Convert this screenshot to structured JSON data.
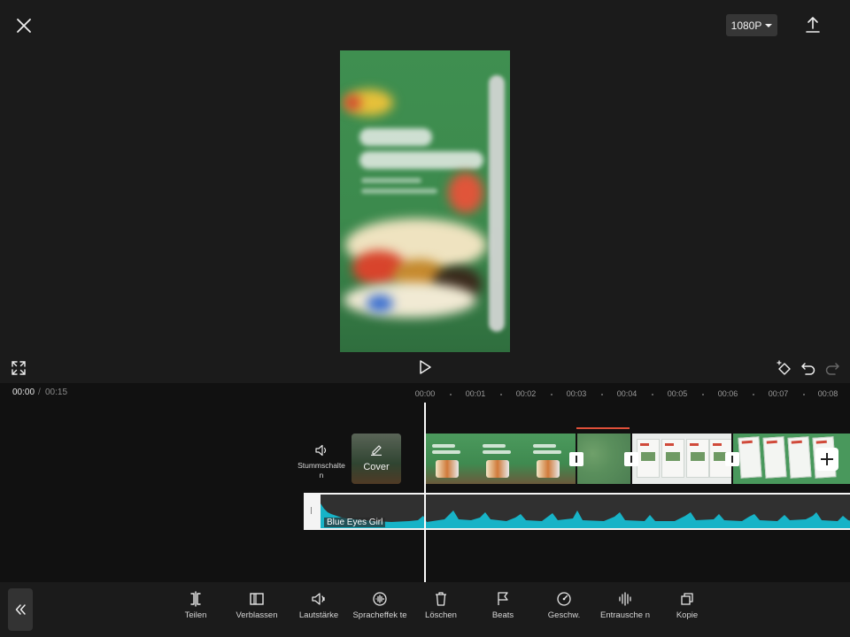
{
  "header": {
    "resolution_label": "1080P"
  },
  "timeline": {
    "current_time": "00:00",
    "separator": "/",
    "total_time": "00:15",
    "ticks": [
      "00:00",
      "00:01",
      "00:02",
      "00:03",
      "00:04",
      "00:05",
      "00:06",
      "00:07",
      "00:08"
    ],
    "mute_label": "Stummschalte n",
    "cover_label": "Cover",
    "audio_track_name": "Blue Eyes Girl"
  },
  "toolbar": {
    "items": [
      {
        "label": "Teilen",
        "icon": "split-icon"
      },
      {
        "label": "Verblassen",
        "icon": "fade-icon"
      },
      {
        "label": "Lautstärke",
        "icon": "volume-icon"
      },
      {
        "label": "Spracheffek te",
        "icon": "voice-effect-icon"
      },
      {
        "label": "Löschen",
        "icon": "trash-icon"
      },
      {
        "label": "Beats",
        "icon": "flag-icon"
      },
      {
        "label": "Geschw.",
        "icon": "speed-icon"
      },
      {
        "label": "Entrausche n",
        "icon": "denoise-icon"
      },
      {
        "label": "Kopie",
        "icon": "copy-icon"
      }
    ]
  },
  "colors": {
    "background": "#1b1b1b",
    "timeline_bg": "#111111",
    "waveform": "#17b3c7",
    "accent_red": "#e0503a"
  }
}
